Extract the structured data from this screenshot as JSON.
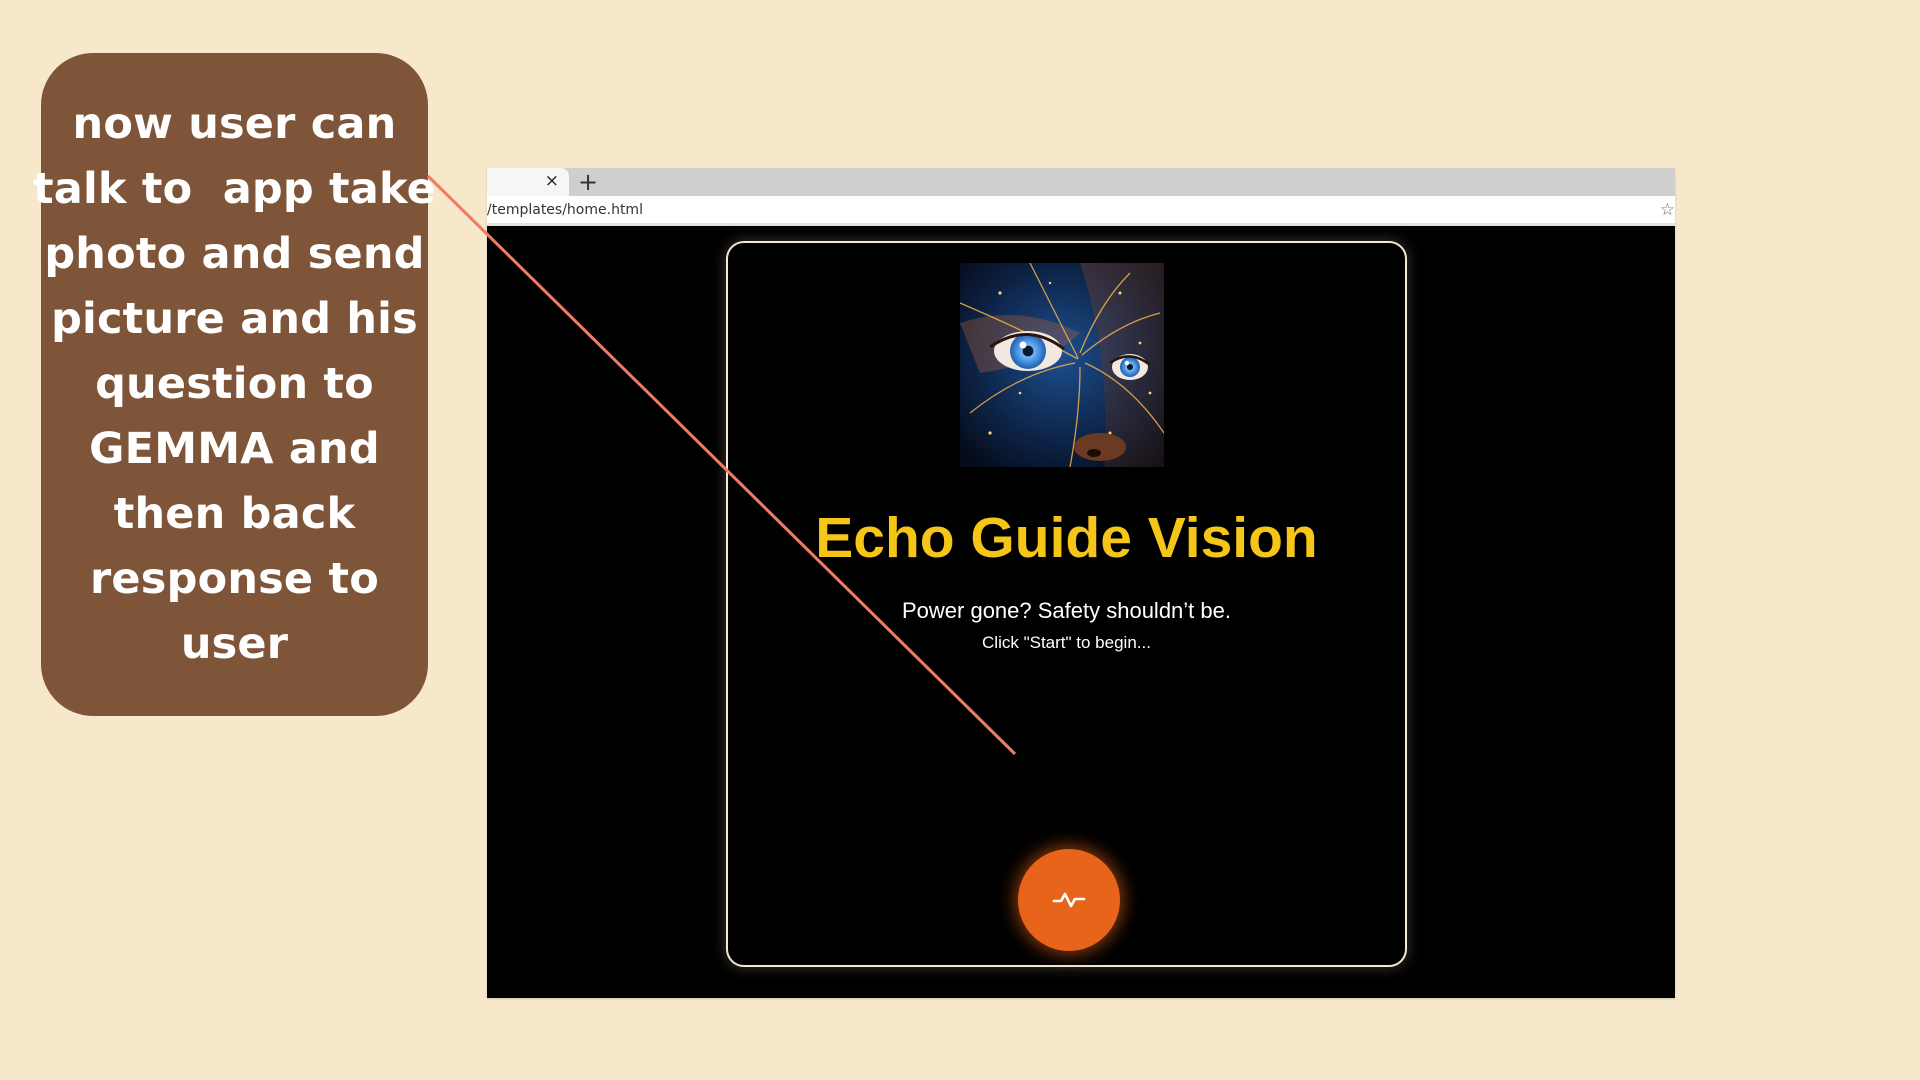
{
  "callout": {
    "lines": [
      "now user can",
      "talk to  app take",
      "photo and send",
      "picture and his",
      "question to",
      "GEMMA and",
      "then back",
      "response to user"
    ]
  },
  "browser": {
    "tab_close": "×",
    "new_tab": "+",
    "url": "/templates/home.html",
    "star_icon": "☆"
  },
  "app": {
    "title": "Echo Guide Vision",
    "subtitle": "Power gone? Safety shouldn’t be.",
    "status": "Click \"Start\" to begin...",
    "start_icon": "activity-icon"
  },
  "colors": {
    "background": "#f7e7cb",
    "callout": "#7f5539",
    "title": "#f5c518",
    "accent": "#e8641a",
    "pointer": "#f07c63"
  }
}
